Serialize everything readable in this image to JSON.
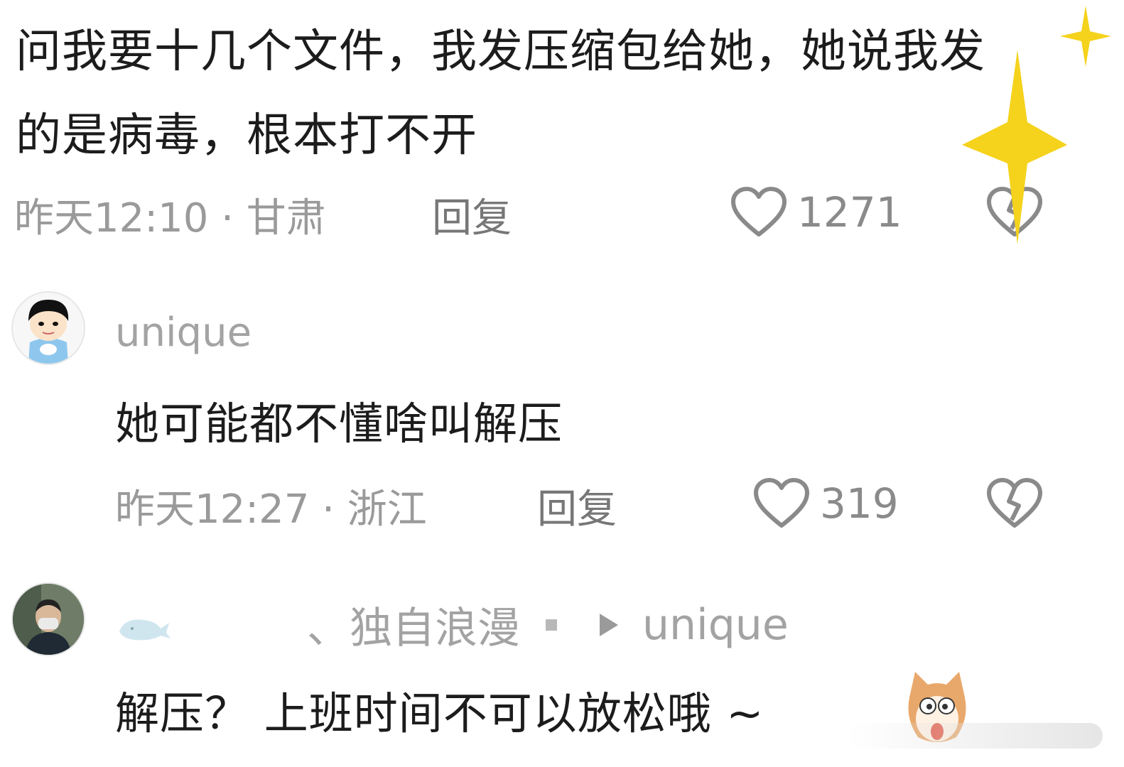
{
  "comments": [
    {
      "text": "问我要十几个文件，我发压缩包给她，她说我发的是病毒，根本打不开",
      "meta": "昨天12:10 · 甘肃",
      "reply_label": "回复",
      "like_count": "1271"
    },
    {
      "username": "unique",
      "text": "她可能都不懂啥叫解压",
      "meta": "昨天12:27 · 浙江",
      "reply_label": "回复",
      "like_count": "319"
    },
    {
      "username": "、独自浪漫",
      "reply_to": "unique",
      "text": "解压？ 上班时间不可以放松哦 ~"
    }
  ],
  "colors": {
    "text": "#1c1c1c",
    "meta": "#9a9a9a",
    "sparkle": "#f5d21c"
  },
  "icons": [
    "heart-icon",
    "broken-heart-icon",
    "sparkle-icon",
    "play-arrow-icon",
    "whale-icon",
    "cartoon-avatar",
    "cat-emoji-icon"
  ]
}
